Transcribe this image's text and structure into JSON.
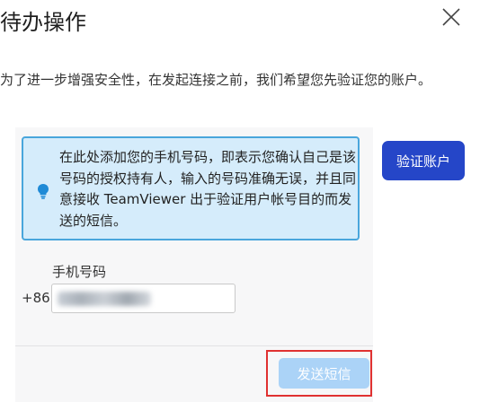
{
  "dialog": {
    "title": "待办操作",
    "description": "为了进一步增强安全性，在发起连接之前，我们希望您先验证您的账户。"
  },
  "info_box": {
    "text": "在此处添加您的手机号码，即表示您确认自己是该号码的授权持有人，输入的号码准确无误，并且同意接收 TeamViewer 出于验证用户帐号目的而发送的短信。"
  },
  "buttons": {
    "verify_label": "验证账户",
    "send_sms_label": "发送短信"
  },
  "phone": {
    "label": "手机号码",
    "country_code": "+86"
  },
  "colors": {
    "primary": "#2546c8",
    "info_bg": "#d5ecfb",
    "info_border": "#49a6dc",
    "disabled_button": "#abd3f7",
    "highlight": "#e03131"
  }
}
